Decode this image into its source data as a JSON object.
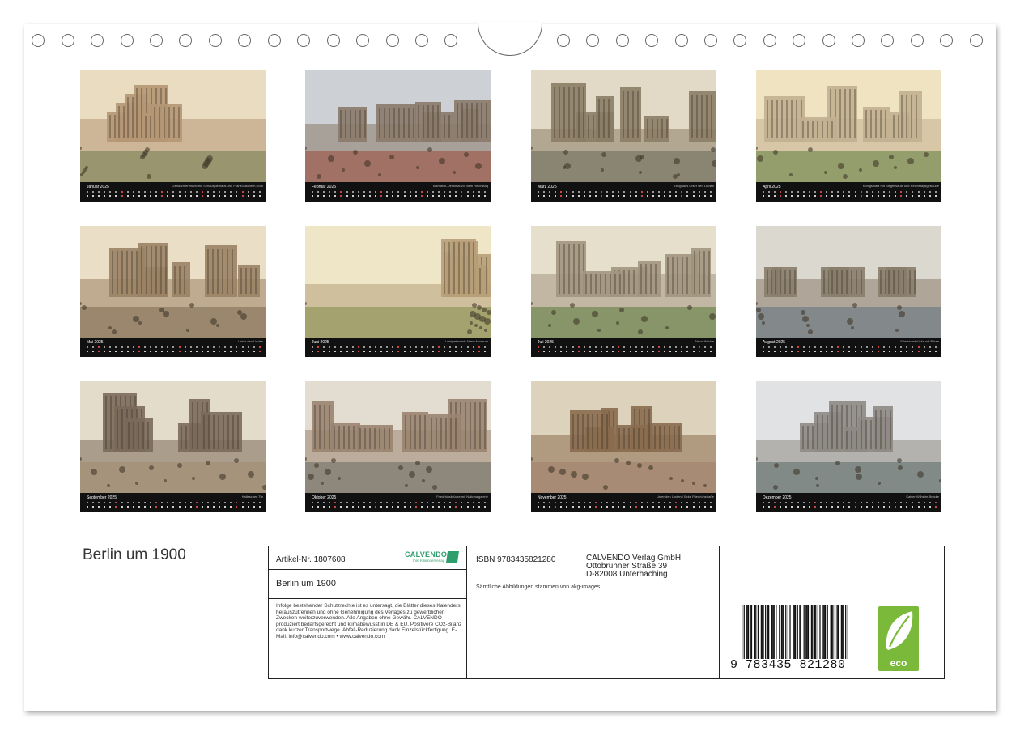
{
  "calendar": {
    "title": "Berlin um 1900",
    "months": [
      {
        "name": "Januar",
        "caption": "Gendarmenmarkt mit Schauspielhaus und Französischem Dom"
      },
      {
        "name": "Februar",
        "caption": "Bismarck-Denkmal vor dem Reichstag"
      },
      {
        "name": "März",
        "caption": "Zeughaus Unter den Linden"
      },
      {
        "name": "April",
        "caption": "Königsplatz mit Siegessäule und Reichstagsgebäude"
      },
      {
        "name": "Mai",
        "caption": "Unter den Linden"
      },
      {
        "name": "Juni",
        "caption": "Lustgarten mit Altem Museum"
      },
      {
        "name": "Juli",
        "caption": "Neue Wache"
      },
      {
        "name": "August",
        "caption": "Friedrichsbrücke mit Börse"
      },
      {
        "name": "September",
        "caption": "Halleschen Tor"
      },
      {
        "name": "Oktober",
        "caption": "Friedrichsbrücke mit Nationalgalerie"
      },
      {
        "name": "November",
        "caption": "Unter den Linden / Ecke Friedrichstraße"
      },
      {
        "name": "Dezember",
        "caption": "Kaiser-Wilhelm-Brücke"
      }
    ],
    "year": "2025"
  },
  "info": {
    "article": "Artikel-Nr. 1807608",
    "brand": "CALVENDO",
    "brand_sub": "Ihre Kalenderverlag",
    "product_title": "Berlin um 1900",
    "legal": "Infolge bestehender Schutzrechte ist es untersagt, die Blätter dieses Kalenders herauszutrennen und ohne Genehmigung des Verlages zu gewerblichen Zwecken weiterzuverwenden. Alle Angaben ohne Gewähr. CALVENDO produziert bedarfsgerecht und klimabewusst in DE & EU. Positivere CO2-Bilanz dank kurzer Transportwege. Abfall-Reduzierung dank Einzelstückfertigung. E-Mail: info@calvendo.com • www.calvendo.com",
    "isbn": "ISBN 9783435821280",
    "publisher_name": "CALVENDO Verlag GmbH",
    "publisher_street": "Ottobrunner Straße 39",
    "publisher_city": "D-82008 Unterhaching",
    "image_credit": "Sämtliche Abbildungen stammen von akg-images",
    "barcode_digits": "9 783435 821280",
    "eco_label": "eco"
  },
  "colors": {
    "eco_green": "#7ab93a",
    "calvendo_green": "#2e9e6e",
    "calendar_strip": "#111111",
    "sunday": "#cc4444"
  }
}
